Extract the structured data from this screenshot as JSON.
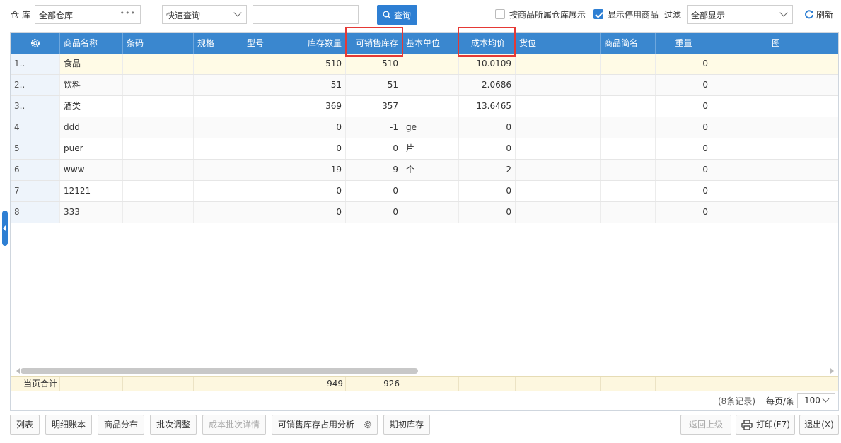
{
  "toolbar": {
    "warehouse_label": "仓 库",
    "warehouse_value": "全部仓库",
    "query_mode": "快速查询",
    "search_value": "",
    "search_button": "查询",
    "by_warehouse_label": "按商品所属仓库展示",
    "by_warehouse_checked": false,
    "show_disabled_label": "显示停用商品",
    "show_disabled_checked": true,
    "filter_label": "过滤",
    "filter_value": "全部显示",
    "refresh_label": "刷新"
  },
  "table": {
    "columns": [
      "商品名称",
      "条码",
      "规格",
      "型号",
      "库存数量",
      "可销售库存",
      "基本单位",
      "成本均价",
      "货位",
      "商品简名",
      "重量",
      "图"
    ],
    "highlighted_columns": [
      "可销售库存",
      "成本均价"
    ],
    "rows": [
      {
        "idx": "1..",
        "name": "食品",
        "barcode": "",
        "spec": "",
        "model": "",
        "qty": "510",
        "sellable": "510",
        "unit": "",
        "cost": "10.0109",
        "location": "",
        "short": "",
        "weight": "0",
        "img": ""
      },
      {
        "idx": "2..",
        "name": "饮料",
        "barcode": "",
        "spec": "",
        "model": "",
        "qty": "51",
        "sellable": "51",
        "unit": "",
        "cost": "2.0686",
        "location": "",
        "short": "",
        "weight": "0",
        "img": ""
      },
      {
        "idx": "3..",
        "name": "酒类",
        "barcode": "",
        "spec": "",
        "model": "",
        "qty": "369",
        "sellable": "357",
        "unit": "",
        "cost": "13.6465",
        "location": "",
        "short": "",
        "weight": "0",
        "img": ""
      },
      {
        "idx": "4",
        "name": "ddd",
        "barcode": "",
        "spec": "",
        "model": "",
        "qty": "0",
        "sellable": "-1",
        "unit": "ge",
        "cost": "0",
        "location": "",
        "short": "",
        "weight": "0",
        "img": ""
      },
      {
        "idx": "5",
        "name": "puer",
        "barcode": "",
        "spec": "",
        "model": "",
        "qty": "0",
        "sellable": "0",
        "unit": "片",
        "cost": "0",
        "location": "",
        "short": "",
        "weight": "0",
        "img": ""
      },
      {
        "idx": "6",
        "name": "www",
        "barcode": "",
        "spec": "",
        "model": "",
        "qty": "19",
        "sellable": "9",
        "unit": "个",
        "cost": "2",
        "location": "",
        "short": "",
        "weight": "0",
        "img": ""
      },
      {
        "idx": "7",
        "name": "12121",
        "barcode": "",
        "spec": "",
        "model": "",
        "qty": "0",
        "sellable": "0",
        "unit": "",
        "cost": "0",
        "location": "",
        "short": "",
        "weight": "0",
        "img": ""
      },
      {
        "idx": "8",
        "name": "333",
        "barcode": "",
        "spec": "",
        "model": "",
        "qty": "0",
        "sellable": "0",
        "unit": "",
        "cost": "0",
        "location": "",
        "short": "",
        "weight": "0",
        "img": ""
      }
    ],
    "footer": {
      "label": "当页合计",
      "qty_total": "949",
      "sellable_total": "926"
    }
  },
  "pagination": {
    "records": "(8条记录)",
    "per_page_label": "每页/条",
    "per_page_value": "100"
  },
  "bottom_buttons": {
    "list": "列表",
    "detail_ledger": "明细账本",
    "distribution": "商品分布",
    "batch_adjust": "批次调整",
    "cost_batch": "成本批次详情",
    "sellable_analysis": "可销售库存占用分析",
    "initial_stock": "期初库存",
    "back": "返回上级",
    "print": "打印(F7)",
    "exit": "退出(X)"
  },
  "colors": {
    "header": "#3a87cf",
    "primary": "#2e7fd3",
    "highlight": "#e53935",
    "footer": "#fdf7df"
  }
}
